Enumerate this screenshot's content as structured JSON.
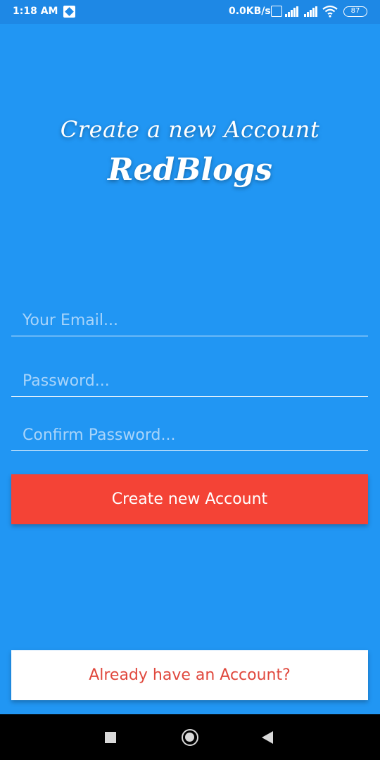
{
  "status_bar": {
    "time": "1:18 AM",
    "net_speed": "0.0KB/s",
    "battery": "87",
    "icons": [
      "notification-icon",
      "volte-icon",
      "signal-icon",
      "signal-icon",
      "wifi-icon",
      "battery-icon"
    ]
  },
  "header": {
    "subtitle": "Create a new Account",
    "app_name": "RedBlogs"
  },
  "form": {
    "email_placeholder": "Your Email...",
    "email_value": "",
    "password_placeholder": "Password...",
    "password_value": "",
    "confirm_placeholder": "Confirm Password...",
    "confirm_value": "",
    "create_label": "Create new Account"
  },
  "footer": {
    "login_label": "Already have an Account?"
  },
  "colors": {
    "background": "#2196F3",
    "primary_button": "#F44336",
    "secondary_text": "#E0483D"
  },
  "nav_bar": {
    "icons": [
      "recent-apps-icon",
      "home-icon",
      "back-icon"
    ]
  }
}
